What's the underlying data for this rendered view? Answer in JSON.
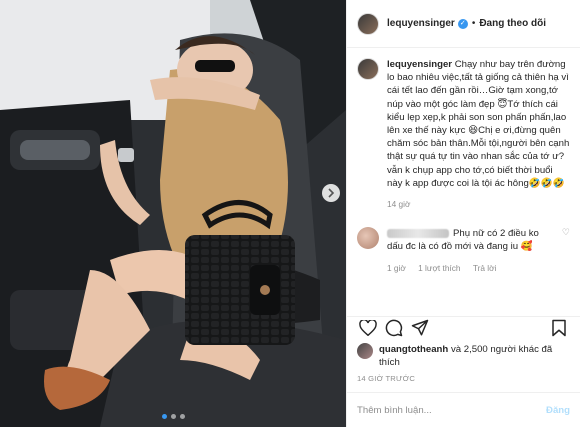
{
  "post": {
    "photo_dots_count": 3,
    "active_dot": 0
  },
  "header": {
    "username": "lequyensinger",
    "separator": "•",
    "follow_label": "Đang theo dõi",
    "verified_icon": "verified-check-icon"
  },
  "caption": {
    "username": "lequyensinger",
    "text": " Chạy như bay trên đường lo bao nhiêu việc,tất tả giống cả thiên hạ vì cái tết lao đến gần rồi…Giờ tạm xong,tớ núp vào một góc làm đẹp 😇Tớ thích cái kiểu lẹp xẹp,k phải son son phấn phấn,lao lên xe thế này kực 😆Chị e ơi,đừng quên chăm sóc bản thân.Mỗi tội,người bên cạnh thật sự quá tự tin vào nhan sắc của tớ ư?vẫn k chụp app cho tớ,có biết thời buổi này k app được coi là tội ác hông🤣🤣🤣",
    "time": "14 giờ"
  },
  "comment2": {
    "text": "Phụ nữ có 2 điều ko dấu đc là có đồ mới và đang iu 🥰",
    "time": "1 giờ",
    "likes": "1 lượt thích",
    "reply": "Trả lời"
  },
  "likes_line": {
    "username": "quangtotheanh",
    "rest": " và 2,500 người khác đã thích"
  },
  "time_ago": "14 GIỜ TRƯỚC",
  "add_comment": {
    "placeholder": "Thêm bình luận...",
    "post_label": "Đăng"
  },
  "colors": {
    "accent": "#3897f0",
    "post_disabled": "#b2dffc",
    "muted": "#8e8e8e",
    "text": "#262626"
  }
}
